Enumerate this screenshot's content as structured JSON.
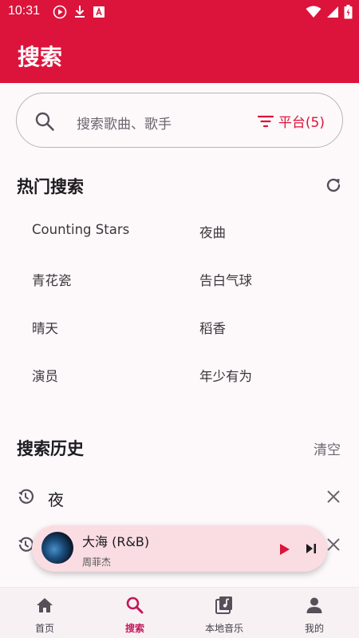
{
  "status_bar": {
    "time": "10:31"
  },
  "app_bar": {
    "title": "搜索"
  },
  "search": {
    "placeholder": "搜索歌曲、歌手",
    "platform_label": "平台(5)"
  },
  "hot_search": {
    "title": "热门搜索",
    "items": [
      "Counting Stars",
      "夜曲",
      "青花瓷",
      "告白气球",
      "晴天",
      "稻香",
      "演员",
      "年少有为"
    ]
  },
  "history": {
    "title": "搜索历史",
    "clear_label": "清空",
    "items": [
      "夜"
    ]
  },
  "player": {
    "song": "大海 (R&B)",
    "artist": "周菲杰"
  },
  "nav": {
    "items": [
      {
        "label": "首页"
      },
      {
        "label": "搜索"
      },
      {
        "label": "本地音乐"
      },
      {
        "label": "我的"
      }
    ],
    "active_index": 1
  },
  "colors": {
    "primary": "#dc143c",
    "nav_active": "#c2185b",
    "player_bg": "#fadde2"
  }
}
